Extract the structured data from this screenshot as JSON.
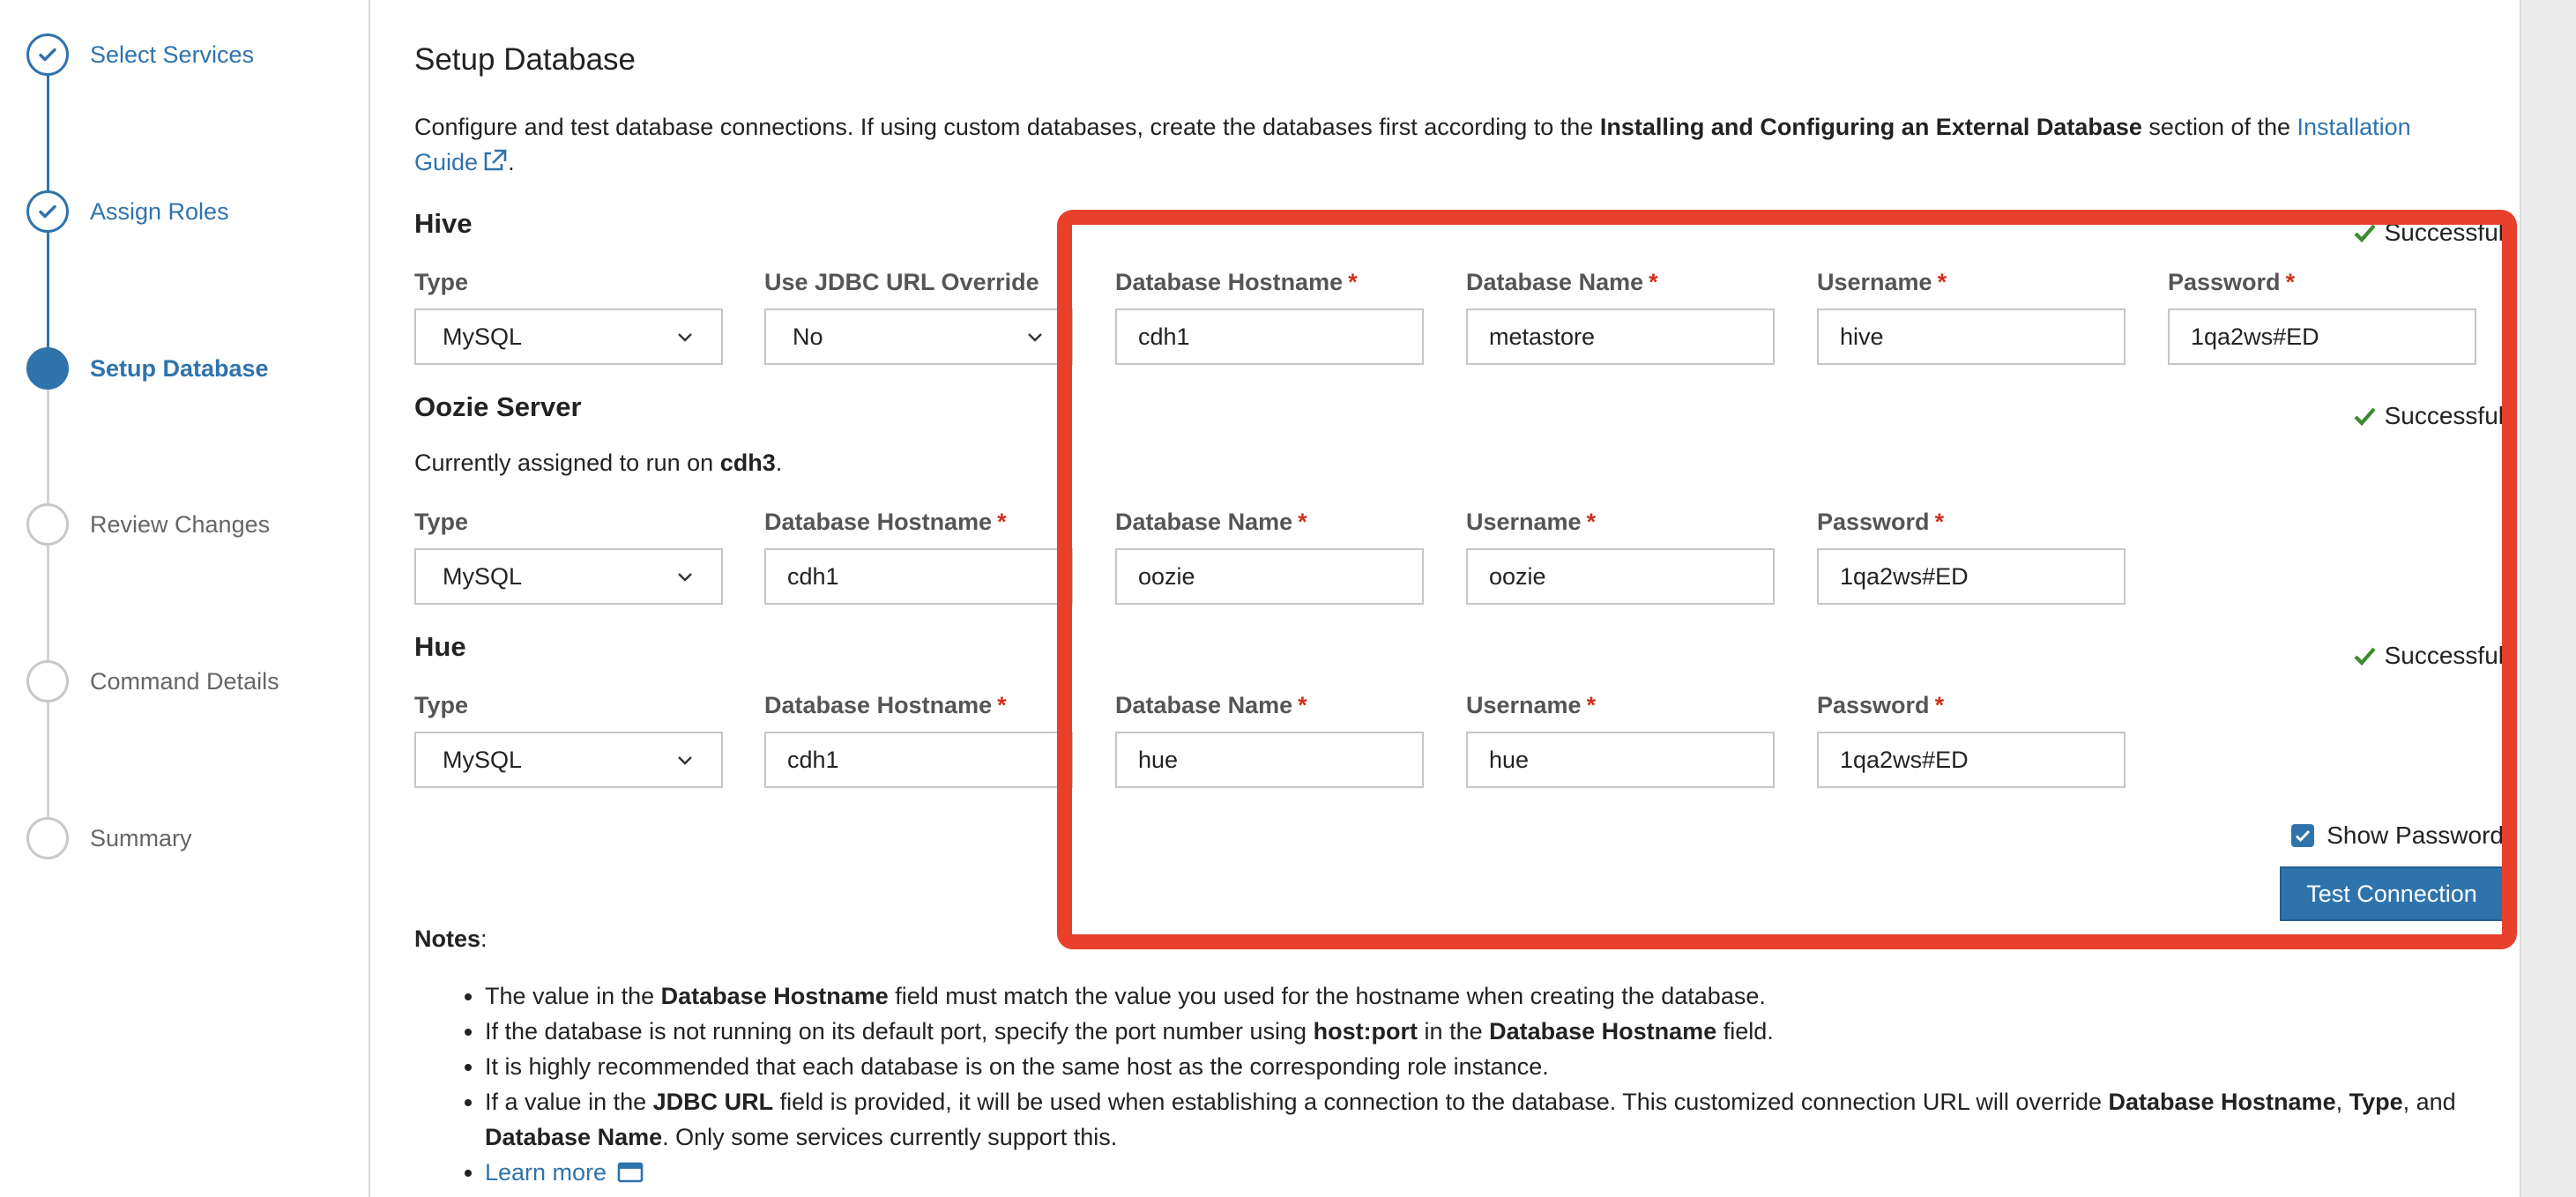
{
  "steps": [
    {
      "label": "Select Services",
      "state": "done"
    },
    {
      "label": "Assign Roles",
      "state": "done"
    },
    {
      "label": "Setup Database",
      "state": "active"
    },
    {
      "label": "Review Changes",
      "state": "todo"
    },
    {
      "label": "Command Details",
      "state": "todo"
    },
    {
      "label": "Summary",
      "state": "todo"
    }
  ],
  "page": {
    "title": "Setup Database",
    "intro_prefix": "Configure and test database connections. If using custom databases, create the databases first according to the ",
    "intro_bold": "Installing and Configuring an External Database",
    "intro_mid": " section of the ",
    "intro_link": "Installation Guide",
    "intro_suffix": "."
  },
  "hive": {
    "title": "Hive",
    "type_label": "Type",
    "type_value": "MySQL",
    "jdbc_label": "Use JDBC URL Override",
    "jdbc_value": "No",
    "host_label": "Database Hostname",
    "host_value": "cdh1",
    "dbname_label": "Database Name",
    "dbname_value": "metastore",
    "user_label": "Username",
    "user_value": "hive",
    "pw_label": "Password",
    "pw_value": "1qa2ws#ED",
    "status": "Successful"
  },
  "oozie": {
    "title": "Oozie Server",
    "assigned_prefix": "Currently assigned to run on ",
    "assigned_host": "cdh3",
    "assigned_suffix": ".",
    "type_label": "Type",
    "type_value": "MySQL",
    "host_label": "Database Hostname",
    "host_value": "cdh1",
    "dbname_label": "Database Name",
    "dbname_value": "oozie",
    "user_label": "Username",
    "user_value": "oozie",
    "pw_label": "Password",
    "pw_value": "1qa2ws#ED",
    "status": "Successful"
  },
  "hue": {
    "title": "Hue",
    "type_label": "Type",
    "type_value": "MySQL",
    "host_label": "Database Hostname",
    "host_value": "cdh1",
    "dbname_label": "Database Name",
    "dbname_value": "hue",
    "user_label": "Username",
    "user_value": "hue",
    "pw_label": "Password",
    "pw_value": "1qa2ws#ED",
    "status": "Successful"
  },
  "required_mark": "*",
  "show_password": {
    "label": "Show Password",
    "checked": true
  },
  "test_button": "Test Connection",
  "notes": {
    "title": "Notes",
    "colon": ":",
    "n1_a": "The value in the ",
    "n1_b": "Database Hostname",
    "n1_c": " field must match the value you used for the hostname when creating the database.",
    "n2_a": "If the database is not running on its default port, specify the port number using ",
    "n2_b": "host:port",
    "n2_c": " in the ",
    "n2_d": "Database Hostname",
    "n2_e": " field.",
    "n3": "It is highly recommended that each database is on the same host as the corresponding role instance.",
    "n4_a": "If a value in the ",
    "n4_b": "JDBC URL",
    "n4_c": " field is provided, it will be used when establishing a connection to the database. This customized connection URL will override ",
    "n4_d": "Database Hostname",
    "n4_e": ", ",
    "n4_f": "Type",
    "n4_g": ", and ",
    "n4_h": "Database Name",
    "n4_i": ". Only some services currently support this.",
    "learn_more": "Learn more"
  },
  "colors": {
    "accent": "#2f73ad",
    "highlight": "#e8402a",
    "success": "#3c8a2e",
    "required": "#d0311e"
  }
}
